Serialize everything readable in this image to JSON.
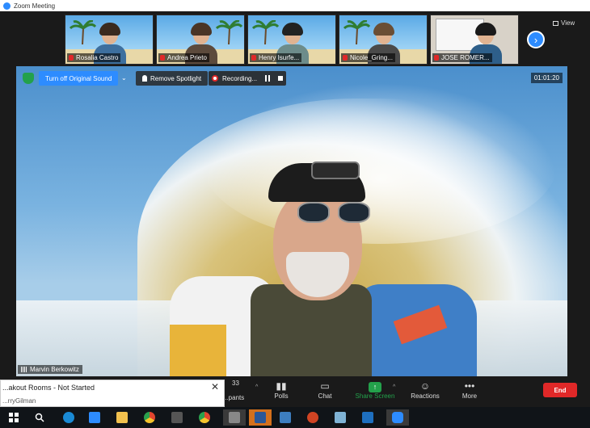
{
  "window": {
    "title": "Zoom Meeting"
  },
  "participants": [
    {
      "name": "Rosalia Castro",
      "muted": true
    },
    {
      "name": "Andrea Prieto",
      "muted": true
    },
    {
      "name": "Henry Isurfe...",
      "muted": true
    },
    {
      "name": "Nicole_Gring...",
      "muted": true
    },
    {
      "name": "JOSE ROMER...",
      "muted": true
    }
  ],
  "strip": {
    "view_label": "View",
    "next_icon": "chevron-right-icon"
  },
  "meeting_bar": {
    "sound_button": "Turn off Original Sound",
    "spotlight_button": "Remove Spotlight",
    "recording_label": "Recording...",
    "timer": "01:01:20"
  },
  "speaker": {
    "name": "Marvin Berkowitz"
  },
  "toolbar": {
    "participants_count": "33",
    "participants_label": "...pants",
    "polls": "Polls",
    "chat": "Chat",
    "share_screen": "Share Screen",
    "reactions": "Reactions",
    "more": "More",
    "end": "End"
  },
  "breakout": {
    "title": "...akout Rooms - Not Started",
    "name": "...rryGilman",
    "close": "✕"
  },
  "colors": {
    "zoom_blue": "#2d8cff",
    "end_red": "#e02828",
    "share_green": "#23a14b"
  }
}
